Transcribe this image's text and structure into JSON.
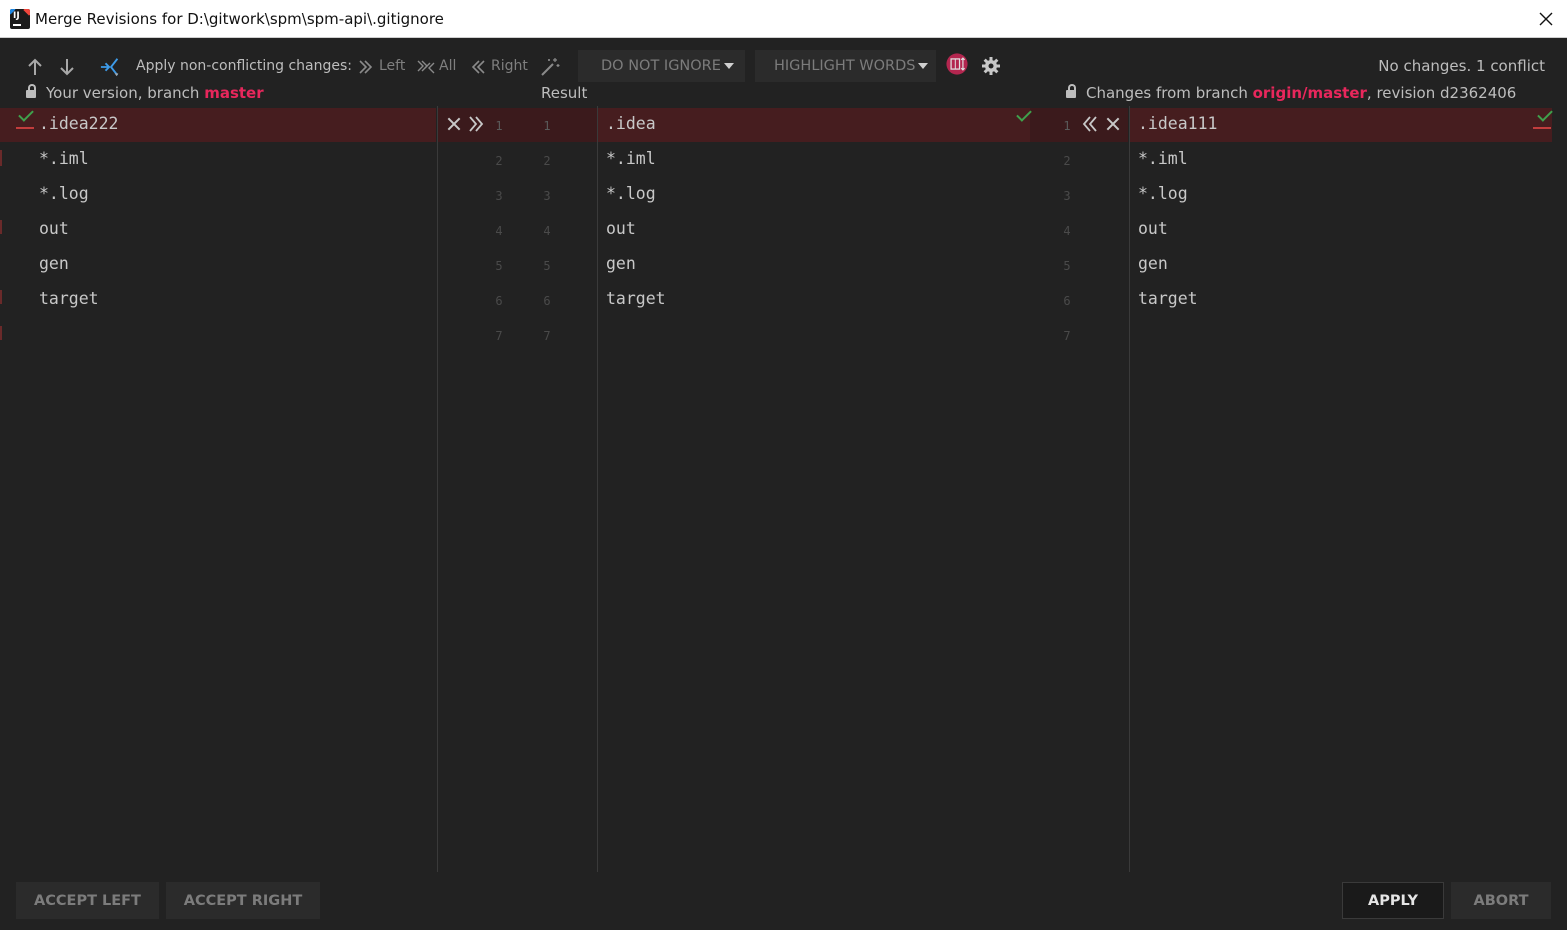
{
  "window": {
    "title": "Merge Revisions for D:\\gitwork\\spm\\spm-api\\.gitignore"
  },
  "toolbar": {
    "apply_label": "Apply non-conflicting changes:",
    "left": "Left",
    "all": "All",
    "right": "Right",
    "ignore_combo": "DO NOT IGNORE",
    "highlight_combo": "HIGHLIGHT WORDS",
    "status": "No changes. 1 conflict"
  },
  "headers": {
    "left_prefix": "Your version, branch ",
    "left_branch": "master",
    "center": "Result",
    "right_prefix": "Changes from branch ",
    "right_branch": "origin/master",
    "right_suffix": ", revision d2362406"
  },
  "left_lines": [
    ".idea222",
    "*.iml",
    "*.log",
    "out",
    "gen",
    "target"
  ],
  "center_lines": [
    ".idea",
    "*.iml",
    "*.log",
    "out",
    "gen",
    "target"
  ],
  "right_lines": [
    ".idea111",
    "*.iml",
    "*.log",
    "out",
    "gen",
    "target"
  ],
  "line_numbers": [
    "1",
    "2",
    "3",
    "4",
    "5",
    "6",
    "7"
  ],
  "buttons": {
    "accept_left": "ACCEPT LEFT",
    "accept_right": "ACCEPT RIGHT",
    "apply": "APPLY",
    "abort": "ABORT"
  }
}
